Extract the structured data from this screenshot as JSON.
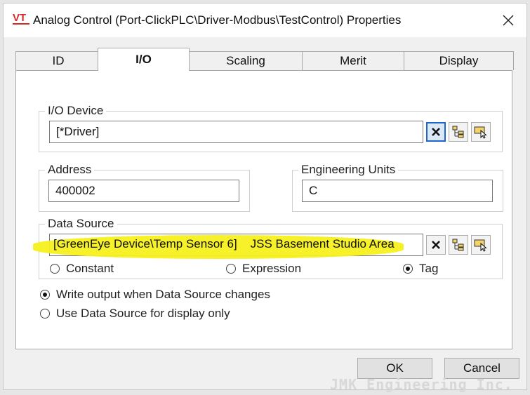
{
  "window": {
    "title": "Analog Control (Port-ClickPLC\\Driver-Modbus\\TestControl) Properties",
    "app_icon_text": "VT",
    "close_glyph": "✕"
  },
  "tabs": [
    {
      "label": "ID",
      "active": false
    },
    {
      "label": "I/O",
      "active": true
    },
    {
      "label": "Scaling",
      "active": false
    },
    {
      "label": "Merit",
      "active": false
    },
    {
      "label": "Display",
      "active": false
    }
  ],
  "io_device": {
    "label": "I/O Device",
    "value": "[*Driver]"
  },
  "address": {
    "label": "Address",
    "value": "400002"
  },
  "engineering_units": {
    "label": "Engineering Units",
    "value": "C"
  },
  "data_source": {
    "label": "Data Source",
    "value": "[GreenEye Device\\Temp Sensor 6]    JSS Basement Studio Area",
    "highlight_color": "#f7f01e",
    "options": [
      {
        "label": "Constant",
        "selected": false
      },
      {
        "label": "Expression",
        "selected": false
      },
      {
        "label": "Tag",
        "selected": true
      }
    ]
  },
  "output_mode": [
    {
      "label": "Write output when Data Source changes",
      "selected": true
    },
    {
      "label": "Use Data Source for display only",
      "selected": false
    }
  ],
  "buttons": {
    "ok": "OK",
    "cancel": "Cancel"
  },
  "watermark": "JMK Engineering Inc.",
  "colors": {
    "accent": "#1e66c9",
    "brand_red": "#d42a2a"
  }
}
